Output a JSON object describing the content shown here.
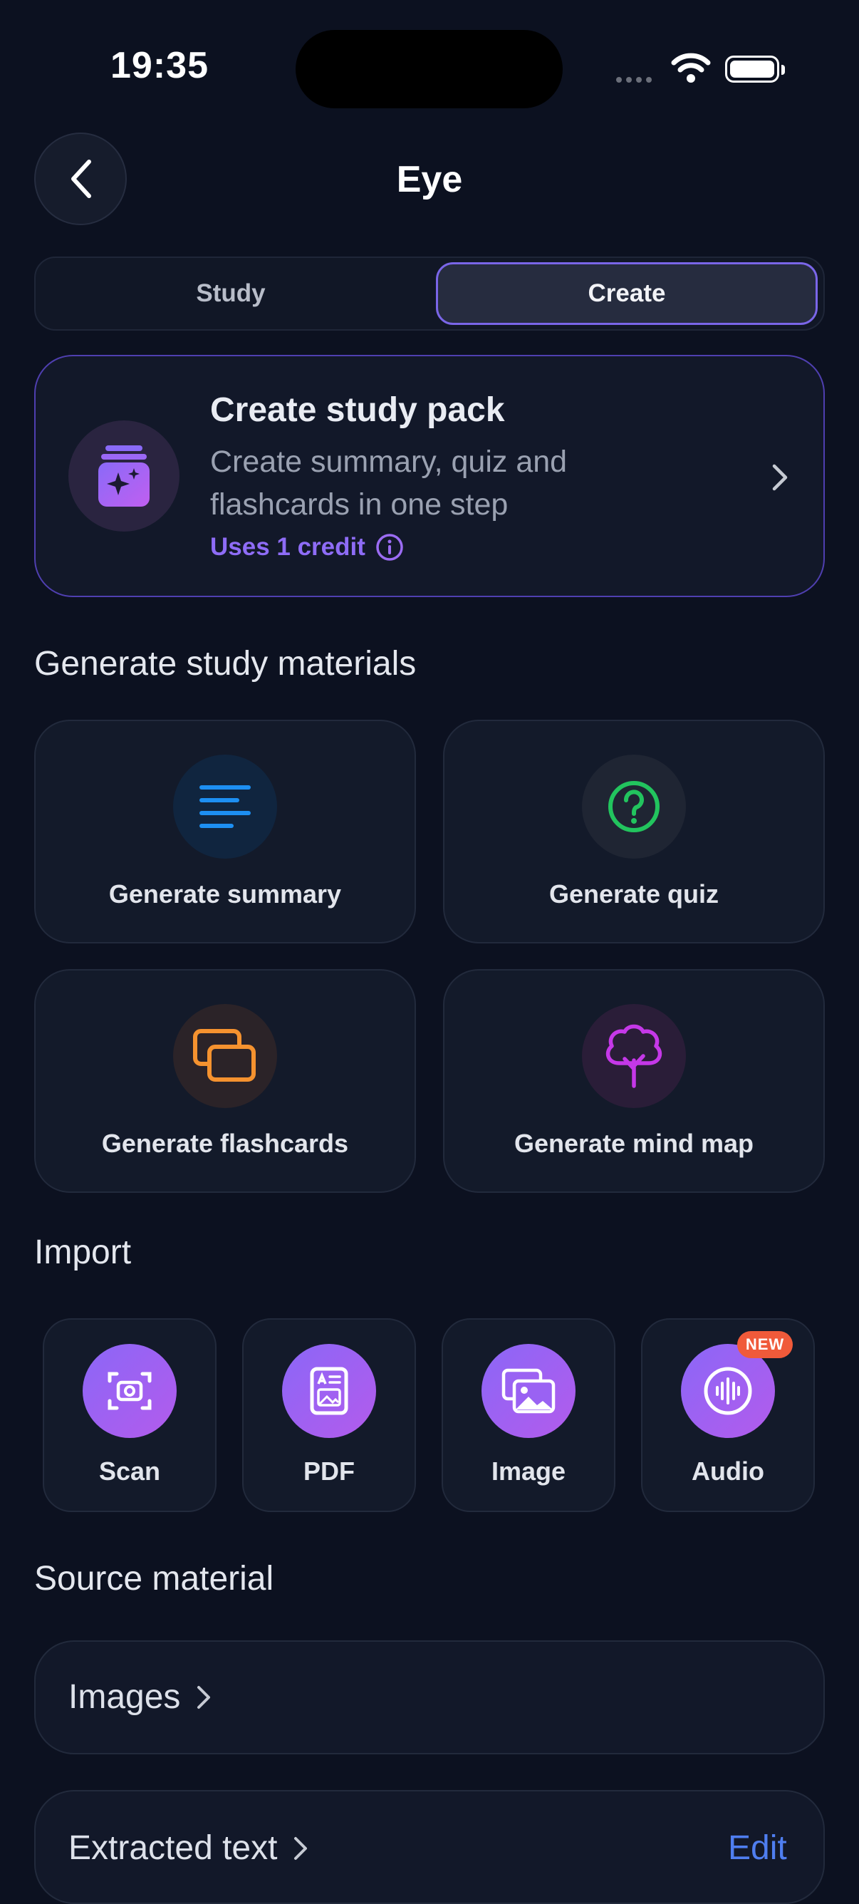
{
  "status_bar": {
    "time": "19:35"
  },
  "header": {
    "title": "Eye"
  },
  "segmented": {
    "study_label": "Study",
    "create_label": "Create",
    "selected": "Create"
  },
  "study_pack": {
    "title": "Create study pack",
    "description": "Create summary, quiz and flashcards in one step",
    "credit": "Uses 1 credit"
  },
  "generate": {
    "section_title": "Generate study materials",
    "items": [
      {
        "label": "Generate summary",
        "icon": "lines-icon",
        "color": "#1d8ff2"
      },
      {
        "label": "Generate quiz",
        "icon": "question-circle-icon",
        "color": "#22c45e"
      },
      {
        "label": "Generate flashcards",
        "icon": "cards-icon",
        "color": "#f5922f"
      },
      {
        "label": "Generate mind map",
        "icon": "tree-icon",
        "color": "#c538e8"
      }
    ]
  },
  "import": {
    "section_title": "Import",
    "items": [
      {
        "label": "Scan",
        "icon": "camera-scan-icon"
      },
      {
        "label": "PDF",
        "icon": "document-icon"
      },
      {
        "label": "Image",
        "icon": "images-icon"
      },
      {
        "label": "Audio",
        "icon": "audio-wave-icon",
        "badge": "NEW"
      }
    ]
  },
  "source": {
    "section_title": "Source material",
    "images_label": "Images",
    "extracted_label": "Extracted text",
    "edit_label": "Edit"
  },
  "colors": {
    "accent": "#7a66e8",
    "link": "#4f7ef0",
    "badge": "#f05a3a",
    "background": "#0c1120"
  }
}
